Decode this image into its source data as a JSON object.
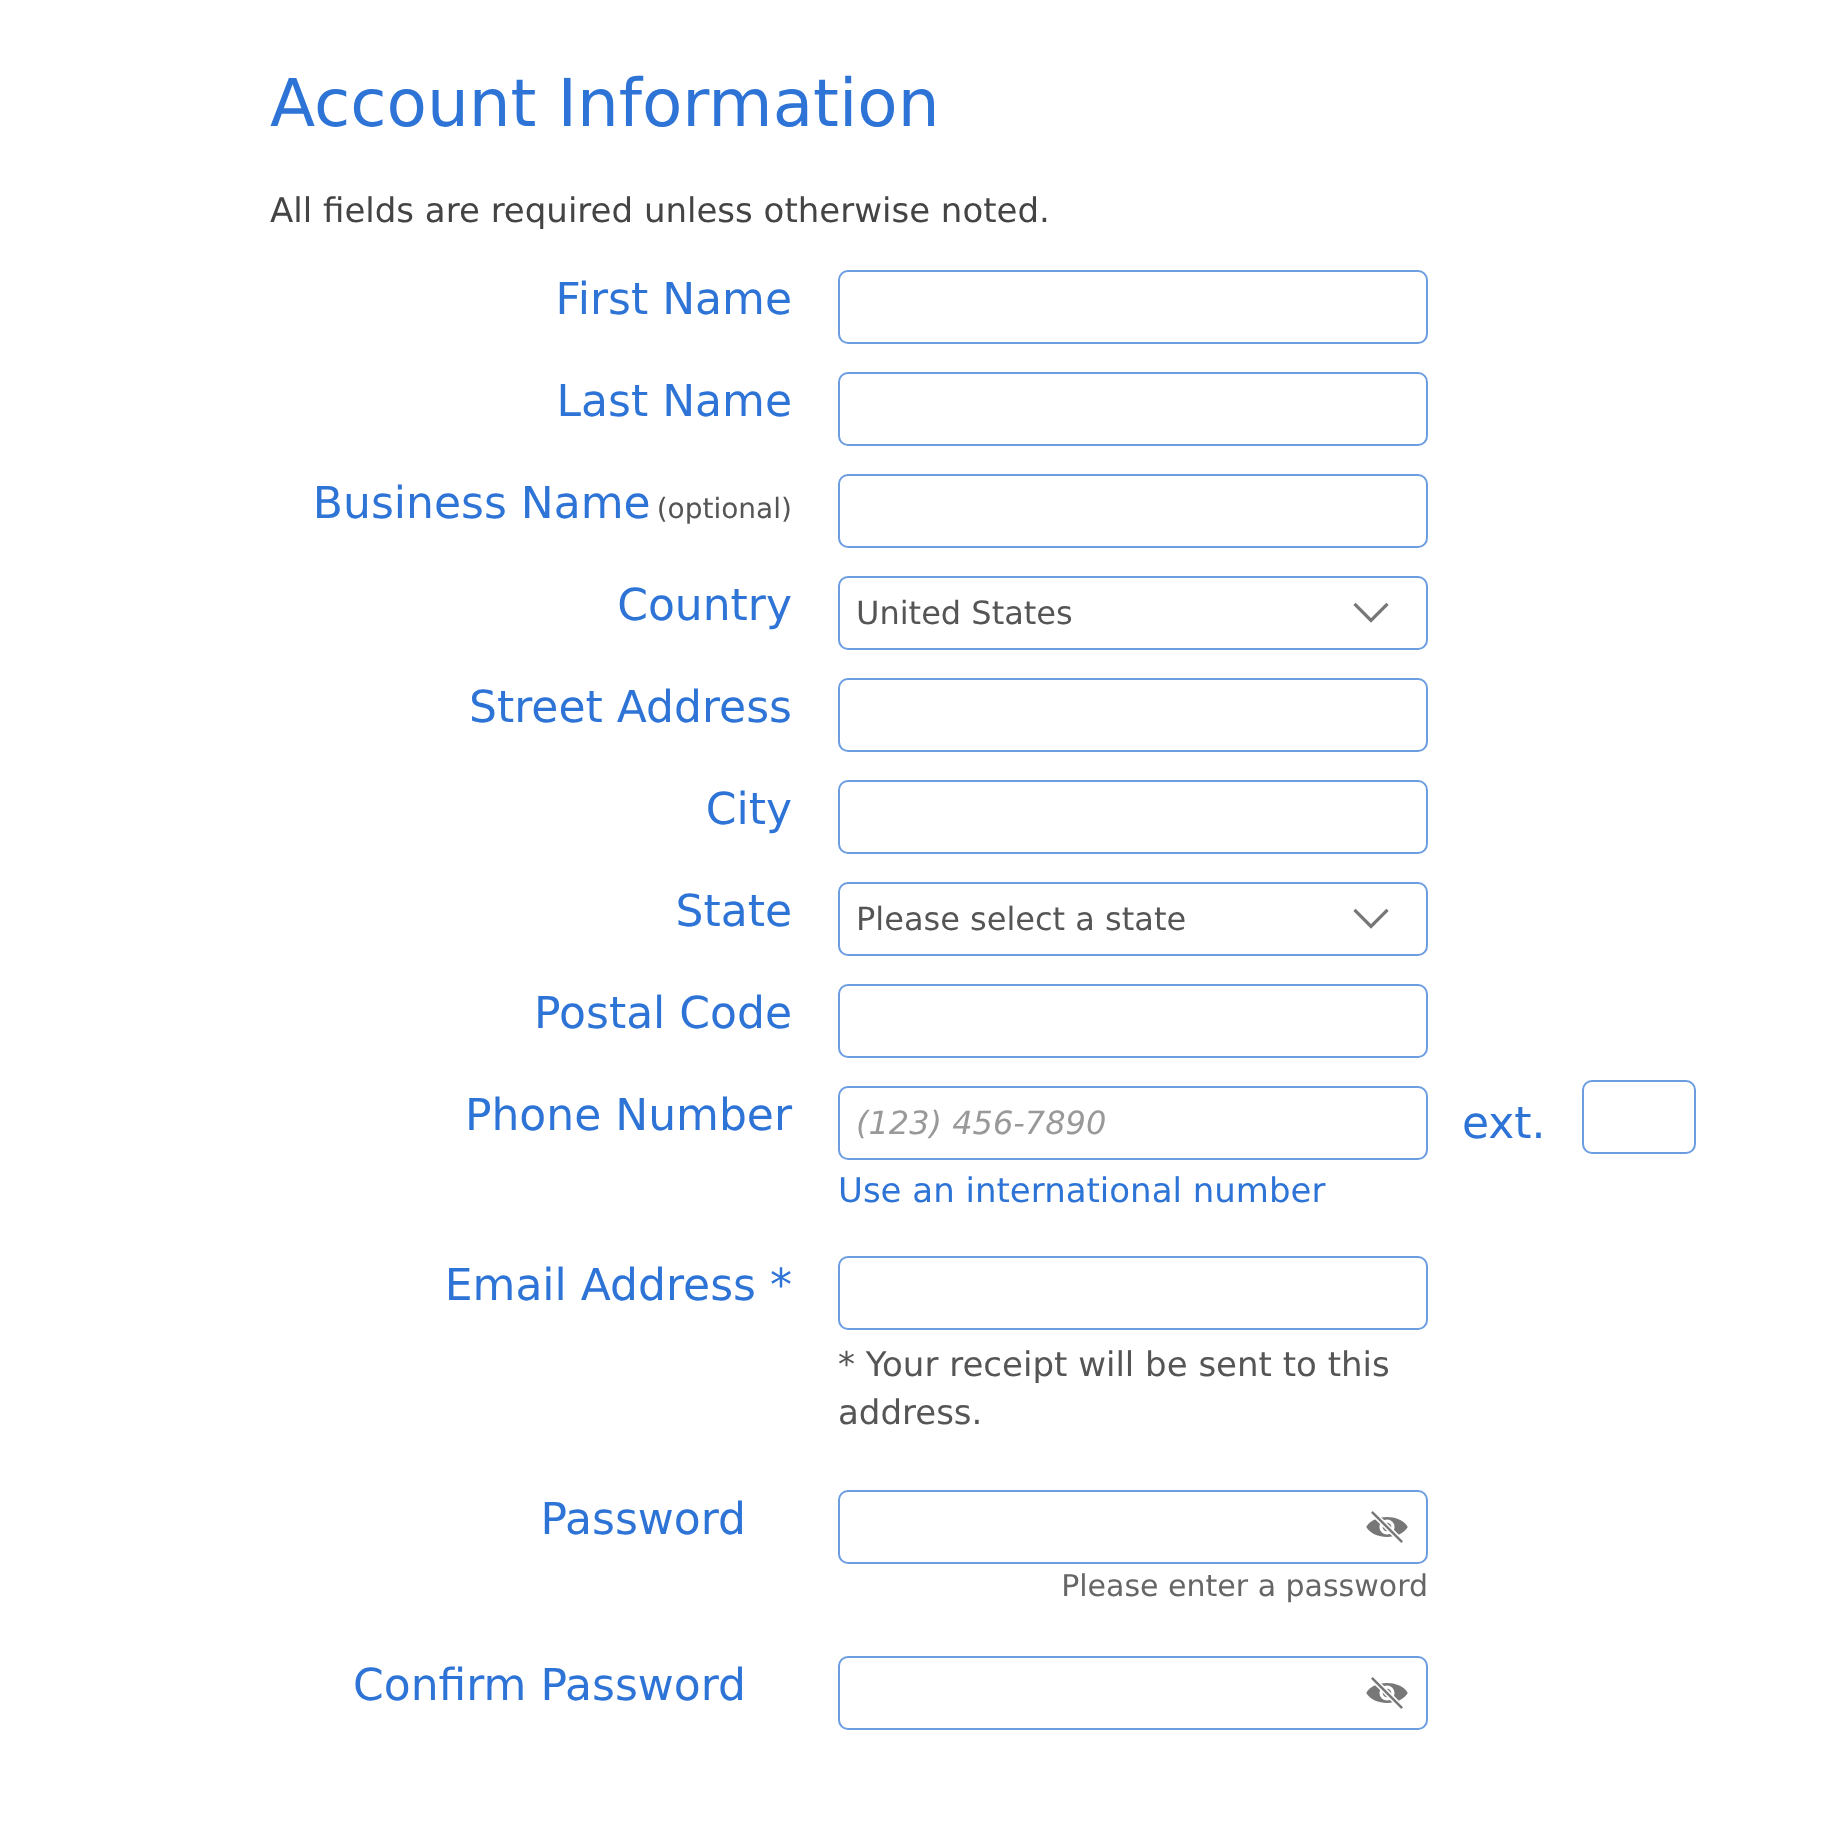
{
  "title": "Account Information",
  "intro": "All fields are required unless otherwise noted.",
  "fields": [
    {
      "kind": "text",
      "label": "First Name"
    },
    {
      "kind": "text",
      "label": "Last Name"
    },
    {
      "kind": "text",
      "label": "Business Name",
      "note": "(optional)"
    },
    {
      "kind": "select",
      "label": "Country",
      "value": "United States"
    },
    {
      "kind": "text",
      "label": "Street Address"
    },
    {
      "kind": "text",
      "label": "City"
    },
    {
      "kind": "select",
      "label": "State",
      "value": "Please select a state"
    },
    {
      "kind": "text",
      "label": "Postal Code"
    },
    {
      "kind": "phone",
      "label": "Phone Number",
      "placeholder": "(123) 456-7890",
      "ext_label": "ext.",
      "link": "Use an international number"
    },
    {
      "kind": "email",
      "label": "Email Address *",
      "help": "* Your receipt will be sent to this address."
    },
    {
      "kind": "password",
      "label": "Password",
      "hint": "Please enter a password"
    },
    {
      "kind": "password",
      "label": "Confirm Password"
    }
  ]
}
